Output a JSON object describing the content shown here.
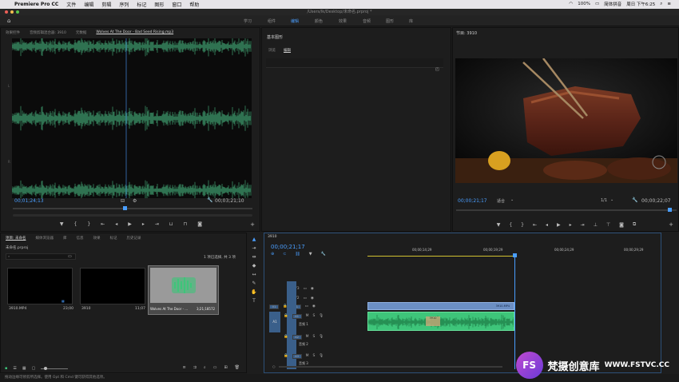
{
  "menubar": {
    "apple": "",
    "app_name": "Premiere Pro CC",
    "items": [
      "文件",
      "编辑",
      "剪辑",
      "序列",
      "标记",
      "图形",
      "窗口",
      "帮助"
    ],
    "status": {
      "battery": "100%",
      "ime": "简体拼音",
      "time": "周日 下午6:25"
    }
  },
  "titlebar": {
    "title": "/Users/lk/Desktop/未命名.prproj *"
  },
  "workspace": {
    "tabs": [
      "学习",
      "组件",
      "编辑",
      "颜色",
      "效果",
      "音频",
      "图形",
      "库"
    ],
    "active_index": 2
  },
  "source_panel": {
    "tabs": [
      "效果控件",
      "音频剪辑混合器: 3910",
      "元数据",
      "Wolves At The Door - Bad Seed Rising.mp3"
    ],
    "active_index": 3,
    "timecode_in": "00;01;24;13",
    "timecode_out": "00;03;21;10",
    "scale_marks": [
      "L",
      "R"
    ]
  },
  "essential_graphics": {
    "title": "基本图形",
    "tabs": [
      "浏览",
      "编辑"
    ],
    "active_index": 1
  },
  "program_panel": {
    "title": "节目: 3910",
    "timecode": "00;00;21;17",
    "fit": "适合",
    "resolution": "1/1",
    "duration": "00;00;22;07"
  },
  "project_panel": {
    "tabs": [
      "项目: 未命名",
      "媒体浏览器",
      "库",
      "信息",
      "效果",
      "标记",
      "历史记录"
    ],
    "active_index": 0,
    "file": "未命名.prproj",
    "selection_info": "1 项已选择, 共 3 项",
    "search_placeholder": "",
    "items": [
      {
        "name": "3910.MP4",
        "duration": "23;00"
      },
      {
        "name": "3910",
        "duration": "11;07"
      },
      {
        "name": "Wolves At The Door - ...",
        "duration": "3;21;18572"
      }
    ]
  },
  "timeline": {
    "sequence": "3910",
    "timecode": "00;00;21;17",
    "ruler": [
      "00;00;14;29",
      "00;00;19;29",
      "00;00;24;29",
      "00;00;29;29"
    ],
    "tracks": [
      {
        "name": "V3"
      },
      {
        "name": "V2"
      },
      {
        "name": "V1"
      },
      {
        "name": "A1",
        "label": "音频 1"
      },
      {
        "name": "A2",
        "label": "音频 2"
      },
      {
        "name": "A3",
        "label": "音频 3"
      }
    ],
    "video_clip": "3910.MP4",
    "audio_clip_marker": "3910"
  },
  "statusbar": {
    "text": "拖动边缘可修剪所选择。使用 Opt 和 Cmd 键可获得其他选项。"
  },
  "watermark": {
    "logo": "FS",
    "brand": "梵摄创意库",
    "url": "WWW.FSTVC.CC"
  },
  "colors": {
    "accent": "#4a9eff",
    "audio_clip": "#3ec57a",
    "video_clip": "#6b8fc4",
    "playhead": "#4a9eff"
  }
}
